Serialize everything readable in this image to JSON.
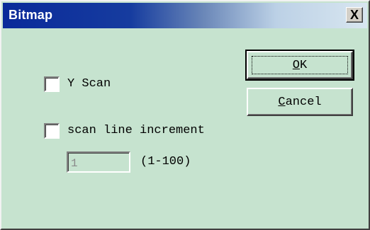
{
  "window": {
    "title": "Bitmap",
    "close_label": "X"
  },
  "buttons": {
    "ok": "OK",
    "ok_mnemonic": "O",
    "ok_rest": "K",
    "cancel_mnemonic": "C",
    "cancel_rest": "ancel"
  },
  "options": {
    "y_scan": {
      "label": "Y Scan",
      "checked": false
    },
    "scan_line_increment": {
      "label": "scan line increment",
      "checked": false,
      "value": "1",
      "range": "(1-100)",
      "enabled": false
    }
  }
}
